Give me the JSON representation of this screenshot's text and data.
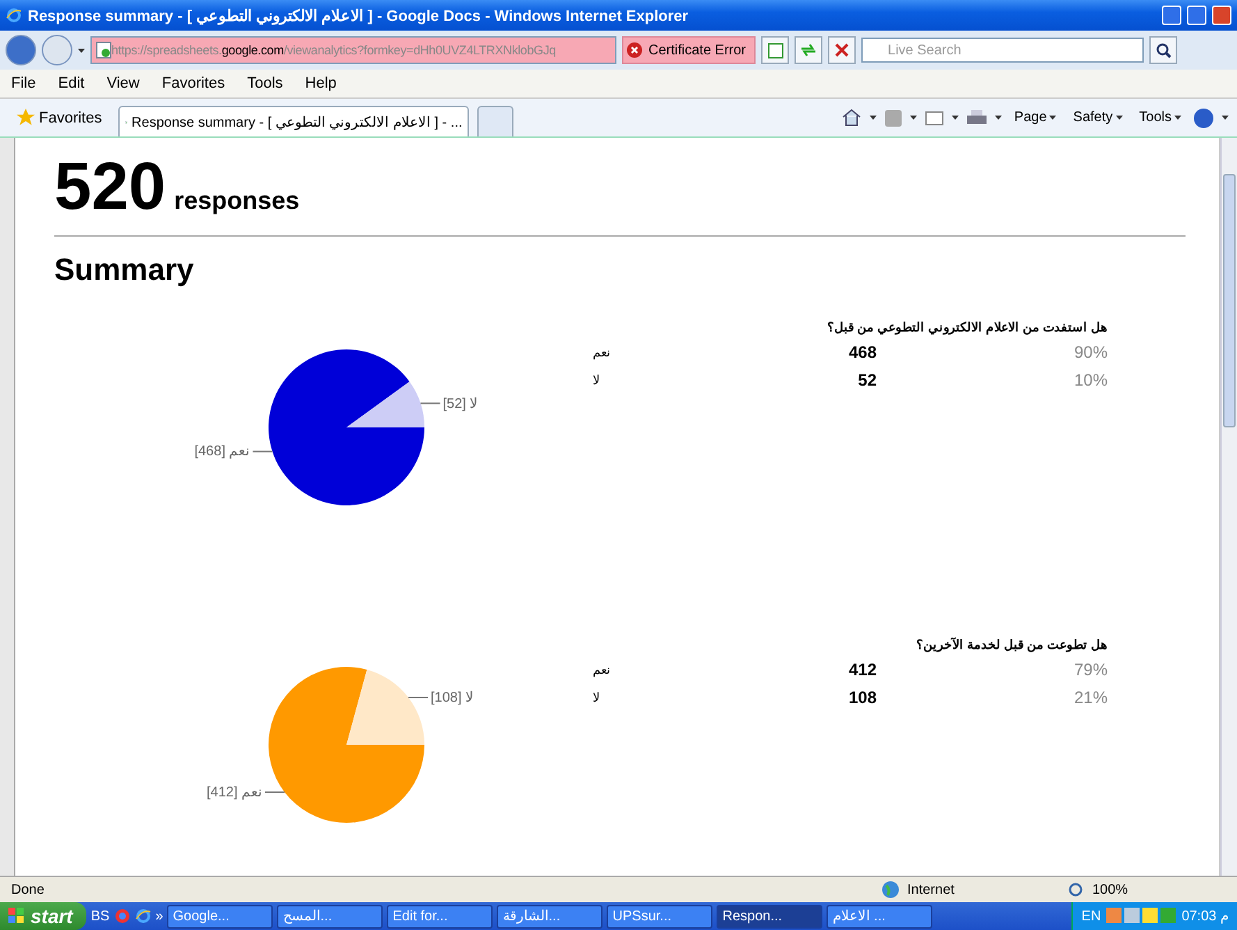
{
  "window": {
    "title": "Response summary - [ الاعلام الالكتروني التطوعي ] - Google Docs - Windows Internet Explorer"
  },
  "address_bar": {
    "url_parts": [
      {
        "text": "https://spreadsheets.",
        "emphasis": false
      },
      {
        "text": "google.com",
        "emphasis": true
      },
      {
        "text": "/viewanalytics?formkey=dHh0UVZ4LTRXNklobGJq",
        "emphasis": false
      }
    ],
    "certificate": "Certificate Error",
    "search": {
      "placeholder": "Live Search"
    }
  },
  "menu": [
    "File",
    "Edit",
    "View",
    "Favorites",
    "Tools",
    "Help"
  ],
  "favorites_bar": {
    "favorites": "Favorites",
    "tabs": [
      {
        "label": "Response summary - [ الاعلام الالكتروني التطوعي ] - ...",
        "selected": true
      }
    ],
    "commands": [
      "Page",
      "Safety",
      "Tools"
    ]
  },
  "page": {
    "count": "520",
    "count_label": "responses",
    "heading": "Summary",
    "questions": [
      {
        "title": "هل استفدت من الاعلام الالكتروني التطوعي من قبل؟",
        "rows": [
          {
            "label": "نعم",
            "count": "468",
            "percent": "90%"
          },
          {
            "label": "لا",
            "count": "52",
            "percent": "10%"
          }
        ],
        "chart_data": {
          "type": "pie",
          "values": [
            468,
            52
          ],
          "colors": [
            "#0000d8",
            "#cdcdf6"
          ],
          "value_labels": [
            "نعم [468]",
            "لا [52]"
          ]
        }
      },
      {
        "title": "هل تطوعت من قبل لخدمة الآخرين؟",
        "rows": [
          {
            "label": "نعم",
            "count": "412",
            "percent": "79%"
          },
          {
            "label": "لا",
            "count": "108",
            "percent": "21%"
          }
        ],
        "chart_data": {
          "type": "pie",
          "values": [
            412,
            108
          ],
          "colors": [
            "#ff9900",
            "#ffe8c8"
          ],
          "value_labels": [
            "نعم [412]",
            "لا [108]"
          ]
        }
      }
    ]
  },
  "status_bar": {
    "text": "Done",
    "zone": "Internet",
    "zoom": "100%"
  },
  "taskbar": {
    "start": "start",
    "quick": "BS",
    "more": "»",
    "items": [
      {
        "label": "Google...",
        "selected": false
      },
      {
        "label": "المسح...",
        "selected": false
      },
      {
        "label": "Edit for...",
        "selected": false
      },
      {
        "label": "الشارقة...",
        "selected": false
      },
      {
        "label": "UPSsur...",
        "selected": false
      },
      {
        "label": "Respon...",
        "selected": true
      },
      {
        "label": "الاعلام ...",
        "selected": false
      }
    ],
    "language": "EN",
    "clock": "07:03 م"
  }
}
